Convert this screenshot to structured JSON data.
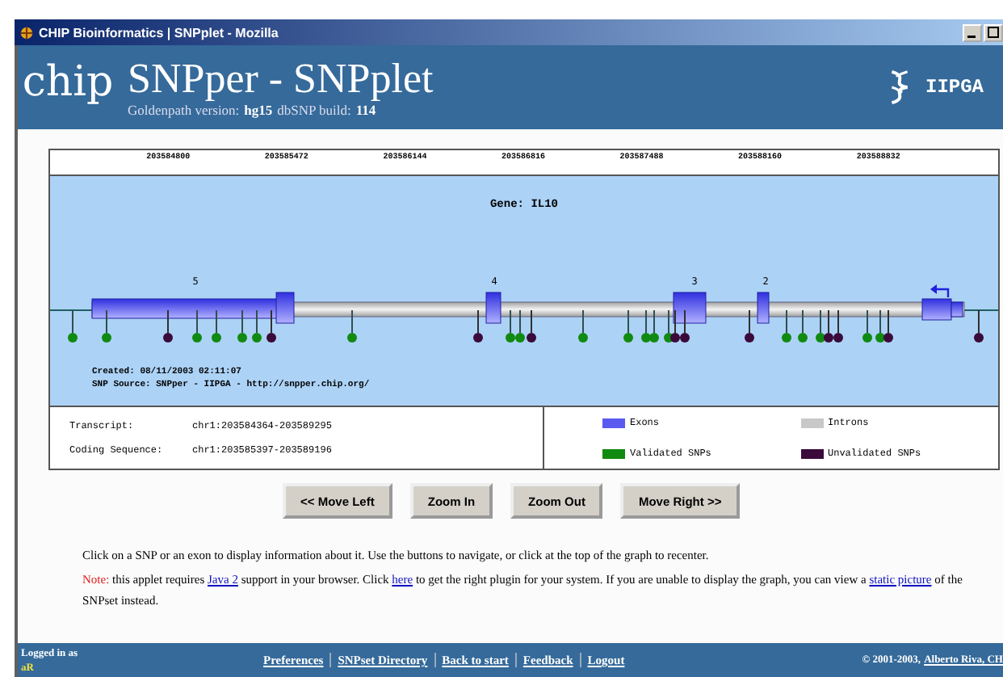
{
  "window": {
    "title": "CHIP Bioinformatics | SNPplet - Mozilla"
  },
  "header": {
    "logo": "chip",
    "title": "SNPper - SNPplet",
    "subtitle_parts": [
      {
        "text": "Goldenpath version:",
        "bold": false
      },
      {
        "text": "hg15",
        "bold": true
      },
      {
        "text": "dbSNP build:",
        "bold": false
      },
      {
        "text": "114",
        "bold": true
      }
    ],
    "partner": "IIPGA"
  },
  "ruler": {
    "labels": [
      "203584800",
      "203585472",
      "203586144",
      "203586816",
      "203587488",
      "203588160",
      "203588832"
    ]
  },
  "gene": {
    "title": "Gene: IL10",
    "exons": [
      {
        "label": "5"
      },
      {
        "label": "4"
      },
      {
        "label": "3"
      },
      {
        "label": "2"
      }
    ],
    "snps": [
      {
        "validated": true
      },
      {
        "validated": true
      },
      {
        "validated": false
      },
      {
        "validated": true
      },
      {
        "validated": true
      },
      {
        "validated": true
      },
      {
        "validated": true
      },
      {
        "validated": false
      },
      {
        "validated": true
      },
      {
        "validated": false
      },
      {
        "validated": true
      },
      {
        "validated": true
      },
      {
        "validated": false
      },
      {
        "validated": true
      },
      {
        "validated": true
      },
      {
        "validated": true
      },
      {
        "validated": true
      },
      {
        "validated": true
      },
      {
        "validated": false
      },
      {
        "validated": false
      },
      {
        "validated": false
      },
      {
        "validated": true
      },
      {
        "validated": true
      },
      {
        "validated": true
      },
      {
        "validated": false
      },
      {
        "validated": false
      },
      {
        "validated": true
      },
      {
        "validated": true
      },
      {
        "validated": false
      },
      {
        "validated": false
      }
    ],
    "created": "Created: 08/11/2003 02:11:07",
    "source": "SNP Source: SNPper - IIPGA - http://snpper.chip.org/"
  },
  "info": [
    {
      "label": "Transcript:",
      "value": "chr1:203584364-203589295"
    },
    {
      "label": "Coding Sequence:",
      "value": "chr1:203585397-203589196"
    }
  ],
  "legend": [
    {
      "label": "Exons",
      "color": "#5a5af0"
    },
    {
      "label": "Introns",
      "color": "#c8c8c8"
    },
    {
      "label": "Validated SNPs",
      "color": "#108a10"
    },
    {
      "label": "Unvalidated SNPs",
      "color": "#3a0a3a"
    }
  ],
  "buttons": [
    "<< Move Left",
    "Zoom In",
    "Zoom Out",
    "Move Right >>"
  ],
  "instructions": "Click on a SNP or an exon to display information about it. Use the buttons to navigate, or click at the top of the graph to recenter.",
  "note": {
    "label": "Note:",
    "parts": [
      {
        "kind": "text",
        "text": "this applet requires"
      },
      {
        "kind": "link",
        "text": "Java 2"
      },
      {
        "kind": "text",
        "text": "support in your browser. Click"
      },
      {
        "kind": "link",
        "text": "here"
      },
      {
        "kind": "text",
        "text": "to get the right plugin for your system. If you are unable to display the graph, you can view a"
      },
      {
        "kind": "link",
        "text": "static picture"
      },
      {
        "kind": "text",
        "text": "of the SNPset instead."
      }
    ]
  },
  "footer": {
    "logged_in": "Logged in as",
    "user": "aR",
    "links": [
      "Preferences",
      "SNPset Directory",
      "Back to start",
      "Feedback",
      "Logout"
    ],
    "copyright": "© 2001-2003,",
    "author": "Alberto Riva, CH"
  }
}
